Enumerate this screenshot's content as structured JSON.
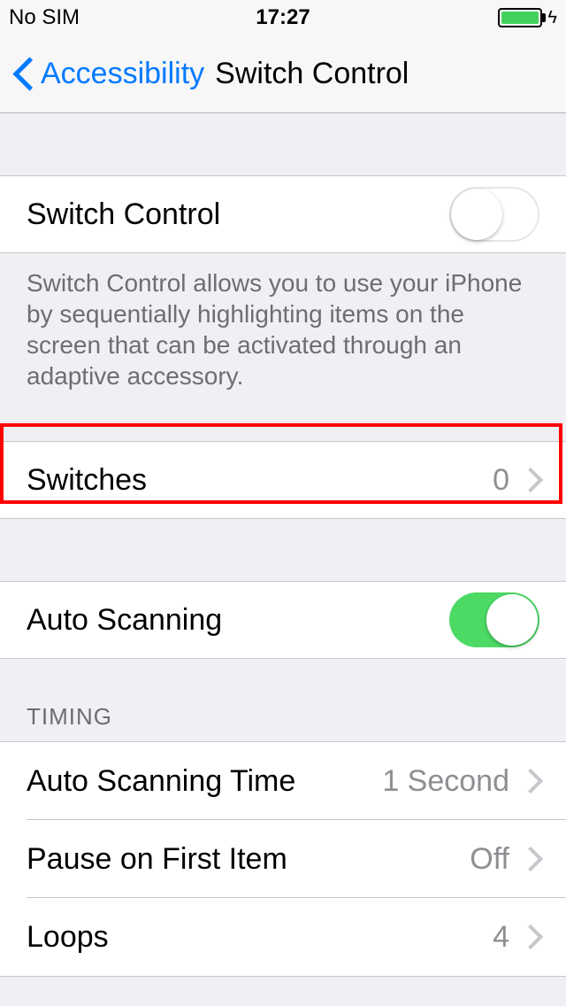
{
  "status": {
    "carrier": "No SIM",
    "time": "17:27"
  },
  "nav": {
    "back_label": "Accessibility",
    "title": "Switch Control"
  },
  "rows": {
    "switch_control": {
      "label": "Switch Control",
      "toggle_on": false
    },
    "description": "Switch Control allows you to use your iPhone by sequentially highlighting items on the screen that can be activated through an adaptive accessory.",
    "switches": {
      "label": "Switches",
      "value": "0"
    },
    "auto_scanning": {
      "label": "Auto Scanning",
      "toggle_on": true
    },
    "timing_header": "TIMING",
    "auto_scanning_time": {
      "label": "Auto Scanning Time",
      "value": "1 Second"
    },
    "pause_first": {
      "label": "Pause on First Item",
      "value": "Off"
    },
    "loops": {
      "label": "Loops",
      "value": "4"
    }
  }
}
